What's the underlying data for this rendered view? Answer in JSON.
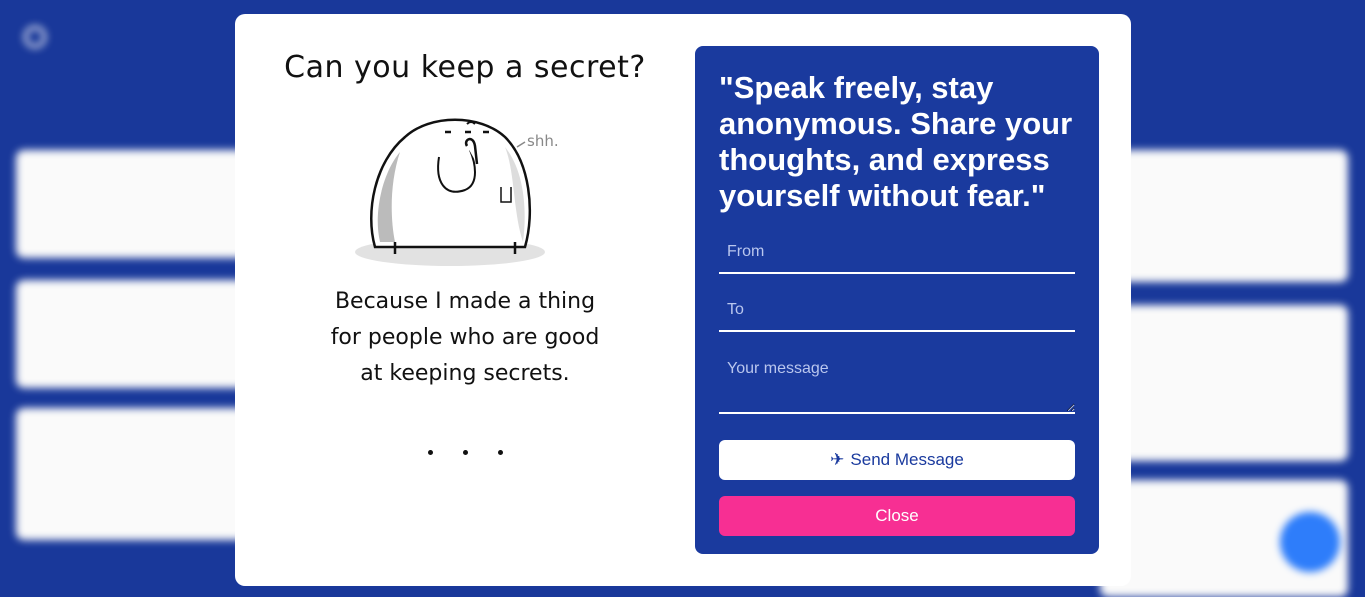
{
  "modal": {
    "left": {
      "heading": "Can you keep a secret?",
      "bubble": "shh.",
      "body_lines": [
        "Because I made a thing",
        "for people who are good",
        "at keeping secrets."
      ]
    },
    "right": {
      "quote": "\"Speak freely, stay anonymous. Share your thoughts, and express yourself without fear.\"",
      "from_placeholder": "From",
      "to_placeholder": "To",
      "message_placeholder": "Your message",
      "send_icon": "✈",
      "send_label": "Send Message",
      "close_label": "Close"
    }
  },
  "colors": {
    "background": "#1a3a9e",
    "panel": "#1a3a9e",
    "close_button": "#f72f93",
    "fab": "#2f80ff"
  }
}
